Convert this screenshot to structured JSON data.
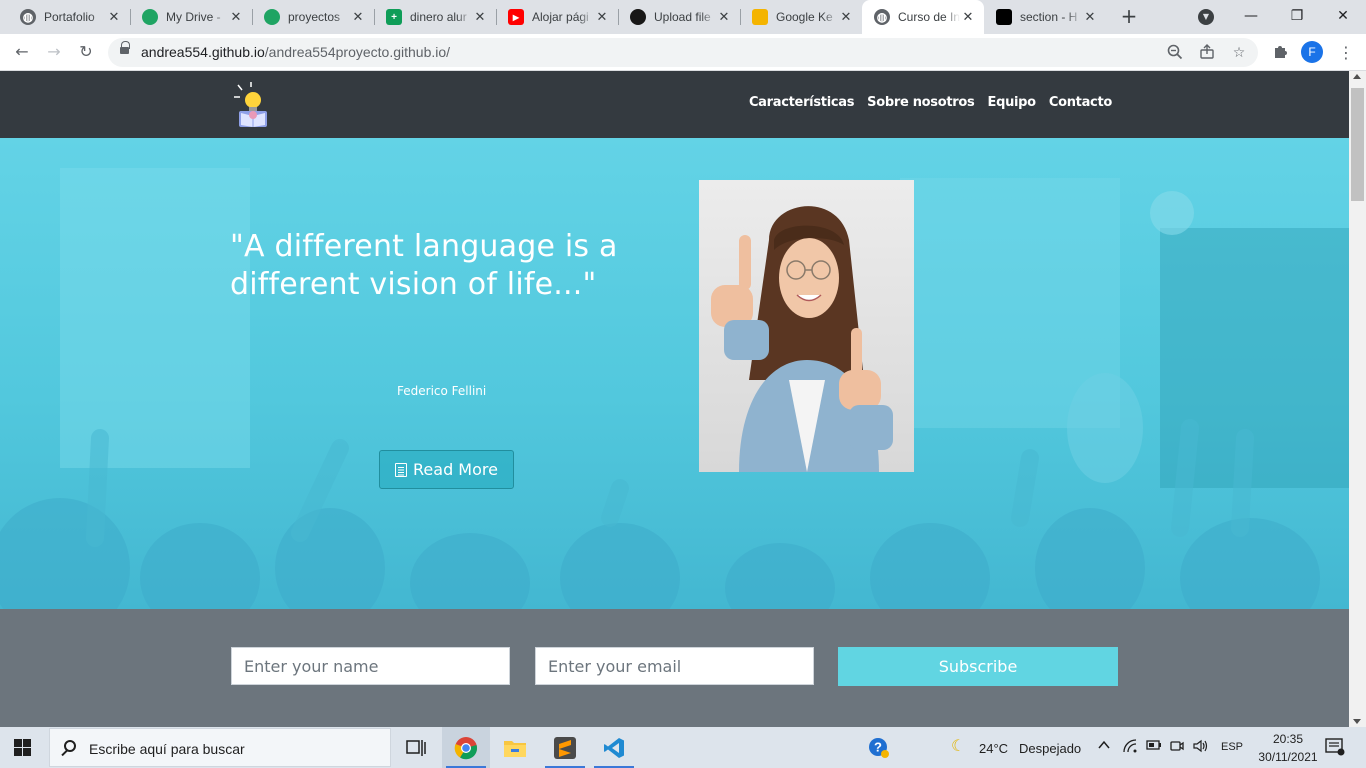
{
  "browser": {
    "tabs": [
      {
        "title": "Portafolio",
        "icon": "globe-icon",
        "color": "#5f6368",
        "active": false
      },
      {
        "title": "My Drive -",
        "icon": "google-drive-icon",
        "color": "#1fa463",
        "active": false
      },
      {
        "title": "proyectos",
        "icon": "google-drive-icon",
        "color": "#1fa463",
        "active": false
      },
      {
        "title": "dinero alur",
        "icon": "google-sheets-icon",
        "color": "#0f9d58",
        "active": false
      },
      {
        "title": "Alojar pági",
        "icon": "youtube-icon",
        "color": "#ff0000",
        "active": false
      },
      {
        "title": "Upload file",
        "icon": "github-icon",
        "color": "#181717",
        "active": false
      },
      {
        "title": "Google Ke",
        "icon": "google-keep-icon",
        "color": "#f4b400",
        "active": false
      },
      {
        "title": "Curso de In",
        "icon": "globe-icon",
        "color": "#5f6368",
        "active": true
      },
      {
        "title": "section - H",
        "icon": "codepen-icon",
        "color": "#000000",
        "active": false
      }
    ],
    "new_tab_label": "+",
    "url_host": "andrea554.github.io",
    "url_path": "/andrea554proyecto.github.io/",
    "profile_initial": "F"
  },
  "site": {
    "nav": [
      "Características",
      "Sobre nosotros",
      "Equipo",
      "Contacto"
    ],
    "hero": {
      "quote": "\"A different language is a different vision of life...\"",
      "author": "Federico Fellini",
      "button": "Read More"
    },
    "subscribe": {
      "name_placeholder": "Enter your name",
      "email_placeholder": "Enter your email",
      "button": "Subscribe"
    },
    "colors": {
      "navbar": "#343a40",
      "hero_tint": "#5ccde0",
      "band": "#6c757d",
      "subscribe_button": "#61d5e2"
    }
  },
  "taskbar": {
    "search_placeholder": "Escribe aquí para buscar",
    "weather_temp": "24°C",
    "weather_desc": "Despejado",
    "language": "ESP",
    "time": "20:35",
    "date": "30/11/2021"
  }
}
